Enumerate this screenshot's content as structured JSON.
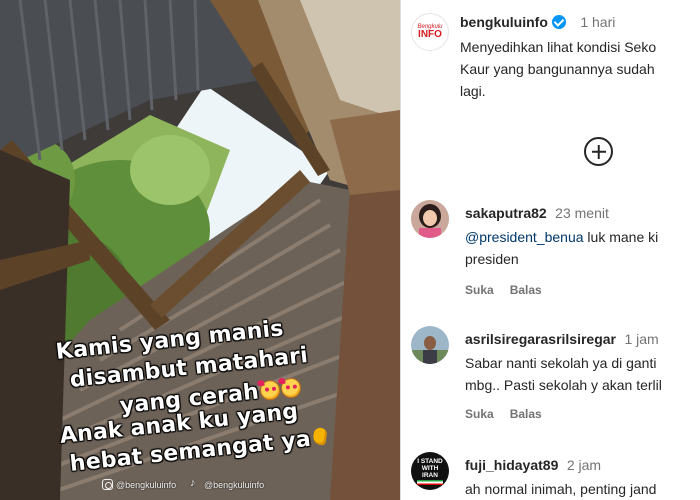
{
  "media": {
    "caption_lines": [
      "Kamis yang manis",
      "disambut matahari",
      "yang cerah",
      "Anak anak ku yang",
      "hebat semangat ya"
    ],
    "caption_emojis": [
      "smiling-face-with-hearts",
      "smiling-face-with-hearts",
      "flexed-biceps"
    ],
    "watermarks": [
      "@bengkuluinfo",
      "@bengkuluinfo"
    ]
  },
  "post": {
    "username": "bengkuluinfo",
    "time": "1 hari",
    "caption_lines": [
      "Menyedihkan lihat kondisi Seko",
      "Kaur yang bangunannya sudah",
      "lagi."
    ],
    "avatar_logo": {
      "line1": "Bengkulu",
      "line2": "INFO"
    }
  },
  "comments": [
    {
      "username": "sakaputra82",
      "time": "23 menit",
      "mention": "@president_benua",
      "lines": [
        "luk mane ki",
        "presiden"
      ],
      "like_label": "Suka",
      "reply_label": "Balas"
    },
    {
      "username": "asrilsiregarasrilsiregar",
      "time": "1 jam",
      "lines": [
        "Sabar nanti sekolah ya di ganti",
        "mbg.. Pasti sekolah y akan terlil"
      ],
      "like_label": "Suka",
      "reply_label": "Balas"
    },
    {
      "username": "fuji_hidayat89",
      "time": "2 jam",
      "lines": [
        "ah normal inimah, penting jand"
      ],
      "avatar_text": [
        "I STAND",
        "WITH",
        "IRAN"
      ]
    }
  ],
  "colors": {
    "link": "#00376b",
    "verified": "#0095f6",
    "muted": "#737373",
    "text": "#262626"
  }
}
